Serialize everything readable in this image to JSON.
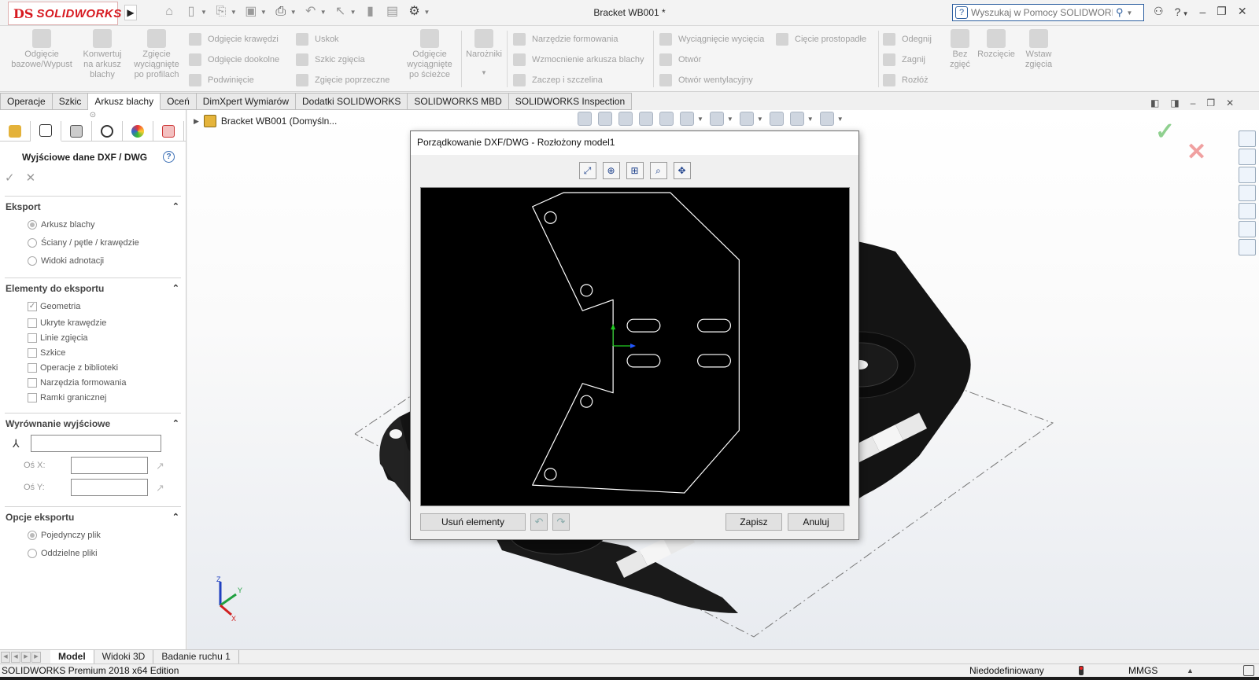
{
  "app": {
    "brand": "SOLIDWORKS",
    "brand_mark": "DS",
    "document_title": "Bracket WB001 *",
    "help_search_placeholder": "Wyszukaj w Pomocy SOLIDWORKS"
  },
  "ribbon": {
    "big_buttons": {
      "base_flange": "Odgięcie bazowe/Wypust",
      "convert": "Konwertuj na arkusz blachy",
      "lofted_bend": "Zgięcie wyciągnięte po profilach",
      "swept_flange": "Odgięcie wyciągnięte po ścieżce",
      "corners": "Narożniki",
      "unfold": "Bez zgięć",
      "rip": "Rozcięcie",
      "insert_bends": "Wstaw zgięcia"
    },
    "col1": [
      "Odgięcie krawędzi",
      "Odgięcie dookolne",
      "Podwinięcie"
    ],
    "col2": [
      "Uskok",
      "Szkic zgięcia",
      "Zgięcie poprzeczne"
    ],
    "col3": [
      "Narzędzie formowania",
      "Wzmocnienie arkusza blachy",
      "Zaczep i szczelina"
    ],
    "col4": [
      "Wyciągnięcie wycięcia",
      "Otwór",
      "Otwór wentylacyjny"
    ],
    "col5": [
      "Cięcie prostopadłe"
    ],
    "col6": [
      "Odegnij",
      "Zagnij",
      "Rozłóż"
    ]
  },
  "tabs": [
    "Operacje",
    "Szkic",
    "Arkusz blachy",
    "Oceń",
    "DimXpert Wymiarów",
    "Dodatki SOLIDWORKS",
    "SOLIDWORKS MBD",
    "SOLIDWORKS Inspection"
  ],
  "active_tab": "Arkusz blachy",
  "property_manager": {
    "title": "Wyjściowe dane DXF / DWG",
    "export": {
      "header": "Eksport",
      "options": [
        "Arkusz blachy",
        "Ściany / pętle / krawędzie",
        "Widoki adnotacji"
      ],
      "selected": "Arkusz blachy"
    },
    "entities": {
      "header": "Elementy do eksportu",
      "items": [
        "Geometria",
        "Ukryte krawędzie",
        "Linie zgięcia",
        "Szkice",
        "Operacje z biblioteki",
        "Narzędzia formowania",
        "Ramki granicznej"
      ],
      "checked": [
        "Geometria"
      ]
    },
    "alignment": {
      "header": "Wyrównanie wyjściowe",
      "x_axis_label": "Oś X:",
      "y_axis_label": "Oś Y:"
    },
    "export_options": {
      "header": "Opcje eksportu",
      "options": [
        "Pojedynczy plik",
        "Oddzielne pliki"
      ],
      "selected": "Pojedynczy plik"
    }
  },
  "graphics": {
    "tree_root": "Bracket WB001  (Domyśln..."
  },
  "dialog": {
    "title": "Porządkowanie DXF/DWG - Rozłożony model1",
    "remove_button": "Usuń elementy",
    "save_button": "Zapisz",
    "cancel_button": "Anuluj"
  },
  "bottom_tabs": [
    "Model",
    "Widoki 3D",
    "Badanie ruchu 1"
  ],
  "active_bottom_tab": "Model",
  "status": {
    "edition": "SOLIDWORKS Premium 2018 x64 Edition",
    "definition": "Niedodefiniowany",
    "units": "MMGS"
  },
  "colors": {
    "brand_red": "#d71920",
    "accent_blue": "#2d5fa0",
    "preview_background": "#000000",
    "model_color": "#141414"
  },
  "triad": {
    "x": "X",
    "y": "Y",
    "z": "Z"
  }
}
